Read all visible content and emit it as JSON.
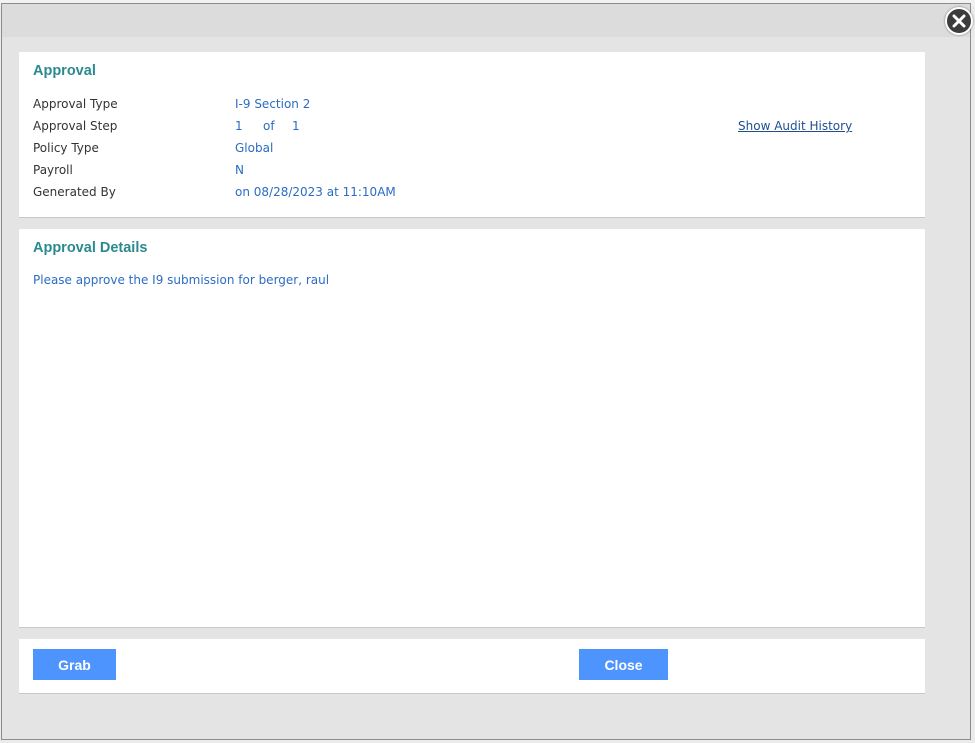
{
  "dialog": {
    "close_icon": "close-circle-icon"
  },
  "approval": {
    "title": "Approval",
    "rows": [
      {
        "label": "Approval Type",
        "value": "I-9 Section 2"
      },
      {
        "label": "Approval Step",
        "value": "1",
        "of_label": "of",
        "total": "1"
      },
      {
        "label": "Policy Type",
        "value": "Global"
      },
      {
        "label": "Payroll",
        "value": "N"
      },
      {
        "label": "Generated By",
        "value": "on 08/28/2023 at 11:10AM"
      }
    ],
    "audit_link": "Show Audit History"
  },
  "details": {
    "title": "Approval Details",
    "message": "Please approve the I9 submission for berger, raul"
  },
  "actions": {
    "grab_label": "Grab",
    "close_label": "Close"
  },
  "colors": {
    "accent_teal": "#2a8a8f",
    "value_blue": "#2b6cc4",
    "button_blue": "#4d94ff"
  }
}
